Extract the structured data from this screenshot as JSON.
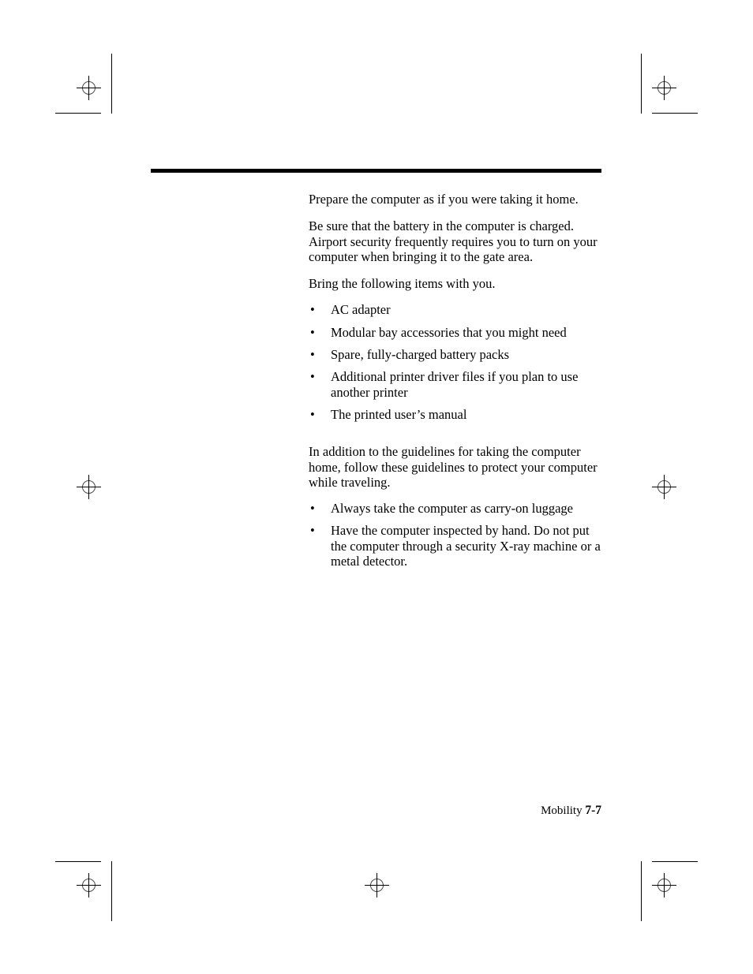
{
  "document": {
    "footer": {
      "section_label": "Mobility",
      "page_number": "7-7"
    },
    "body": {
      "paragraph_1": "Prepare the computer as if you were taking it home.",
      "paragraph_2": "Be sure that the battery in the computer is charged. Airport security frequently requires you to turn on your computer when bringing it to the gate area.",
      "paragraph_3": "Bring the following items with you.",
      "list_1": [
        "AC adapter",
        "Modular bay accessories that you might need",
        "Spare, fully-charged battery packs",
        "Additional printer driver files if you plan to use another printer",
        "The printed user’s manual"
      ],
      "paragraph_4": "In addition to the guidelines for taking the computer home, follow these guidelines to protect your computer while traveling.",
      "list_2": [
        "Always take the computer as carry-on luggage",
        "Have the computer inspected by hand. Do not put the computer through a security X-ray machine or a metal detector."
      ],
      "bullet_glyph": "•"
    },
    "colors": {
      "text": "#000000",
      "rule": "#000000",
      "registration_ring": "#4a4a4a",
      "page_background": "#ffffff"
    }
  }
}
